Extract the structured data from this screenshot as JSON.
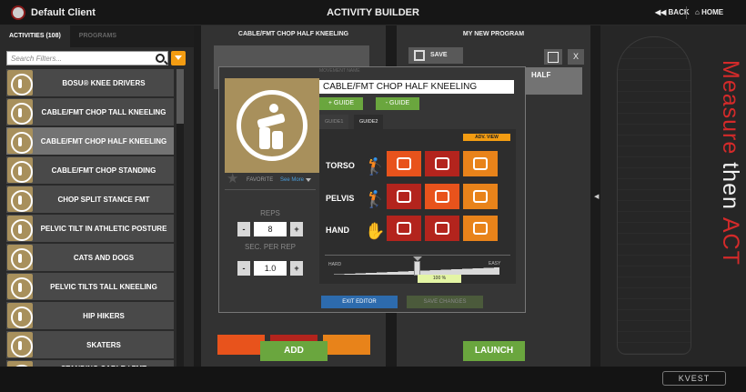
{
  "header": {
    "client": "Default Client",
    "title": "ACTIVITY BUILDER",
    "back": "BACK",
    "home": "HOME"
  },
  "brand": {
    "word1": "Measure",
    "word2": "then",
    "word3": "ACT",
    "logo": "KVEST"
  },
  "colors": {
    "accent": "#f39c12",
    "green": "#6aa63e",
    "red": "#d42a2a",
    "blue": "#2d6bad"
  },
  "left": {
    "tabs": [
      {
        "label": "ACTIVITIES (108)"
      },
      {
        "label": "PROGRAMS"
      }
    ],
    "search_placeholder": "Search Filters...",
    "items": [
      {
        "label": "BOSU® KNEE DRIVERS"
      },
      {
        "label": "CABLE/FMT CHOP TALL KNEELING"
      },
      {
        "label": "CABLE/FMT CHOP HALF KNEELING"
      },
      {
        "label": "CABLE/FMT CHOP STANDING"
      },
      {
        "label": "CHOP SPLIT STANCE FMT"
      },
      {
        "label": "PELVIC TILT IN ATHLETIC POSTURE"
      },
      {
        "label": "CATS AND DOGS"
      },
      {
        "label": "PELVIC TILTS TALL KNEELING"
      },
      {
        "label": "HIP HIKERS"
      },
      {
        "label": "SKATERS"
      },
      {
        "label": "STANDING CABLE / FMT"
      }
    ]
  },
  "middle": {
    "title": "CABLE/FMT CHOP HALF KNEELING",
    "add": "ADD"
  },
  "right": {
    "title": "MY NEW PROGRAM",
    "save": "SAVE",
    "close": "X",
    "item_label": "HALF",
    "launch": "LAUNCH"
  },
  "editor": {
    "movement_label": "MOVEMENT NAME",
    "movement_name": "CABLE/FMT CHOP HALF KNEELING",
    "plus_guide": "+ GUIDE",
    "minus_guide": "- GUIDE",
    "guide_tabs": [
      {
        "label": "GUIDE1"
      },
      {
        "label": "GUIDE2"
      }
    ],
    "adv_view": "ADV. VIEW",
    "favorite": "FAVORITE",
    "see_more": "See More",
    "reps_label": "REPS",
    "reps": "8",
    "sec_label": "SEC. PER REP",
    "sec": "1.0",
    "minus": "-",
    "plus": "+",
    "rows": [
      {
        "label": "TORSO"
      },
      {
        "label": "PELVIS"
      },
      {
        "label": "HAND"
      }
    ],
    "hard": "HARD",
    "easy": "EASY",
    "difficulty": "100 %",
    "exit": "EXIT EDITOR",
    "save_changes": "SAVE CHANGES"
  }
}
